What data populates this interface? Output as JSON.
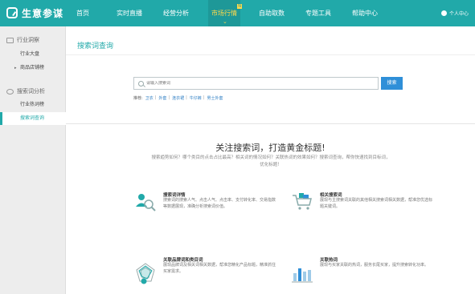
{
  "app": {
    "name": "生意参谋"
  },
  "nav": {
    "items": [
      {
        "label": "首页"
      },
      {
        "label": "实时直播"
      },
      {
        "label": "经营分析"
      },
      {
        "label": "市场行情",
        "badge": "N"
      },
      {
        "label": "自助取数"
      },
      {
        "label": "专题工具"
      },
      {
        "label": "帮助中心"
      }
    ],
    "user_label": "个人中心"
  },
  "sidebar": {
    "sections": [
      {
        "label": "行业洞察",
        "items": [
          {
            "label": "行业大盘"
          },
          {
            "label": "商品店铺榜"
          }
        ]
      },
      {
        "label": "搜索词分析",
        "items": [
          {
            "label": "行业热词榜"
          },
          {
            "label": "搜索词查询"
          }
        ]
      }
    ],
    "active_item": "搜索词查询"
  },
  "search": {
    "page_title": "搜索词查询",
    "placeholder": "请输入搜索词",
    "button_label": "搜索",
    "hint_label": "推荐:",
    "hint_keywords": [
      "卫衣",
      "外套",
      "连衣裙",
      "牛仔裤",
      "男士外套"
    ]
  },
  "intro": {
    "title": "关注搜索词，打造黄金标题!",
    "description": "搜索趋势如何？哪个类目的点击占比最高？相关词的情况如何？关联热词的效果如何？搜索词查询，帮你快速找到目标词，优化标题！"
  },
  "features": [
    {
      "icon": "user-search-icon",
      "title": "搜索词详情",
      "desc": "搜索词的搜索人气、点击人气、点击率、支付转化率、交易指数等数据展现，准确分析搜索词价值。"
    },
    {
      "icon": "cart-icon",
      "title": "相关搜索词",
      "desc": "展现与主搜索词关联的其他相关搜索词相关数据，帮准您优选标题关键词。"
    },
    {
      "icon": "radar-icon",
      "title": "关联品牌词和类目词",
      "desc": "展现品牌词及相关词相关数据，帮准您精化产品标题，精准抓住买家需求。"
    },
    {
      "icon": "bar-chart-icon",
      "title": "关联热词",
      "desc": "展现与买家关联的热词，服务长尾买家，提升搜索转化功率。"
    }
  ],
  "colors": {
    "brand": "#21a9a9",
    "nav_active_text": "#ffd94b",
    "button": "#2f8fd8"
  }
}
